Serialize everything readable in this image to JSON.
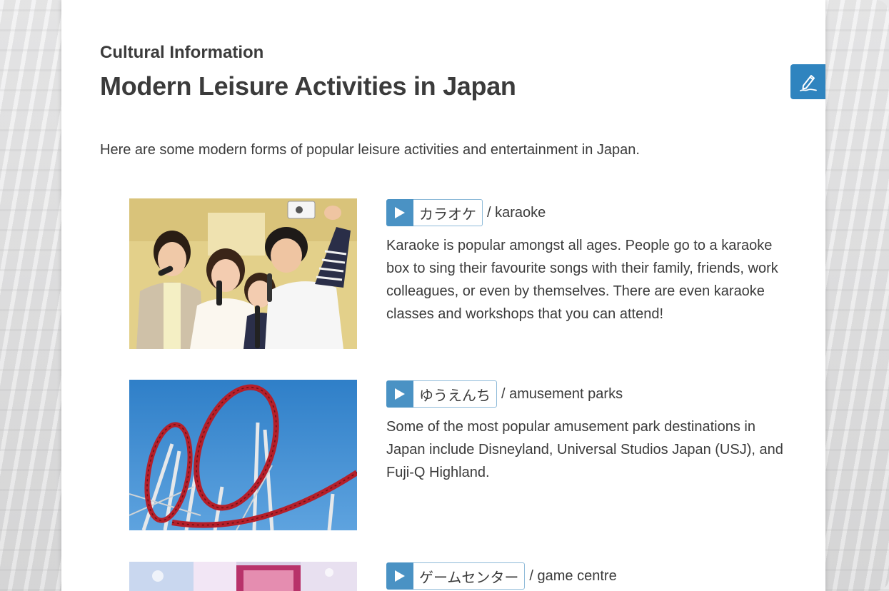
{
  "page": {
    "subtitle": "Cultural Information",
    "title": "Modern Leisure Activities in Japan",
    "intro": "Here are some modern forms of popular leisure activities and entertainment in Japan."
  },
  "toolbar": {
    "note_icon": "pen-note-icon"
  },
  "items": [
    {
      "japanese": "カラオケ",
      "english": "/ karaoke",
      "description": "Karaoke is popular amongst all ages. People go to a karaoke box to sing their favourite songs with their family, friends, work colleagues, or even by themselves. There are even karaoke classes and workshops that you can attend!",
      "image": "karaoke-group-photo"
    },
    {
      "japanese": "ゆうえんち",
      "english": "/ amusement parks",
      "description": "Some of the most popular amusement park destinations in Japan include Disneyland, Universal Studios Japan (USJ), and Fuji-Q Highland.",
      "image": "roller-coaster-photo"
    },
    {
      "japanese": "ゲームセンター",
      "english": "/ game centre",
      "description": "",
      "image": "game-centre-photo"
    }
  ],
  "colors": {
    "accent": "#2f84bf",
    "play_button": "#4a92c4",
    "text": "#3b3b3b"
  }
}
